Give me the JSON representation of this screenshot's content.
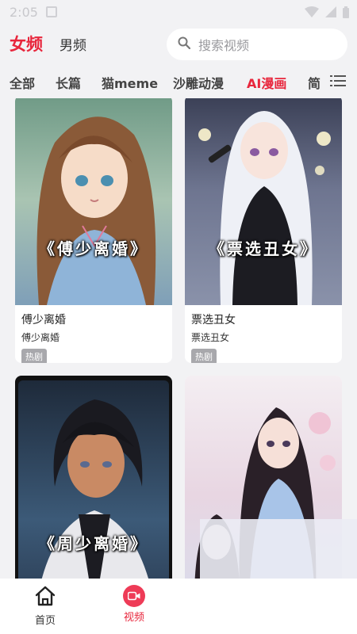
{
  "status": {
    "time": "2:05"
  },
  "header": {
    "tab_female": "女频",
    "tab_male": "男频",
    "search_placeholder": "搜索视频"
  },
  "categories": [
    "全部",
    "长篇",
    "猫meme",
    "沙雕动漫",
    "AI漫画",
    "简"
  ],
  "active_category_index": 4,
  "cards": [
    {
      "cover_text": "《傅少离婚》",
      "title": "傅少离婚",
      "subtitle": "傅少离婚",
      "tag": "热剧"
    },
    {
      "cover_text": "《票选丑女》",
      "title": "票选丑女",
      "subtitle": "票选丑女",
      "tag": "热剧"
    },
    {
      "cover_text": "《周少离婚》",
      "title": "",
      "subtitle": "",
      "tag": ""
    },
    {
      "cover_text": "",
      "title": "",
      "subtitle": "",
      "tag": ""
    }
  ],
  "bottom_nav": {
    "home_label": "首页",
    "video_label": "视频"
  },
  "colors": {
    "accent": "#e8263c",
    "background": "#f2f2f4",
    "tag_bg": "#a8a8ac"
  }
}
